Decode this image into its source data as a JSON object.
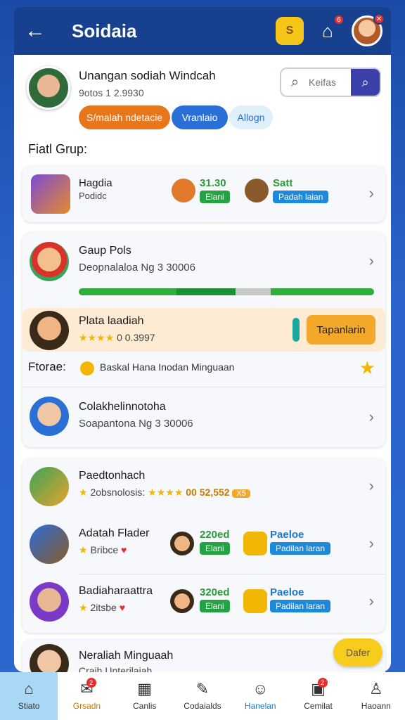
{
  "header": {
    "title": "Soidaia",
    "shield_label": "S",
    "notif_count": "6"
  },
  "profile": {
    "name": "Unangan sodiah Windcah",
    "sub": "9otos 1 2.9930"
  },
  "search": {
    "placeholder": "Keifas"
  },
  "chips": [
    "S/malah ndetacie",
    "Vranlaio",
    "Allogn"
  ],
  "section1": {
    "title": "Fiatl Grup:"
  },
  "card1": {
    "title": "Hagdia",
    "sub": "Podidc",
    "mid_value": "31.30",
    "mid_tag": "Elani",
    "right_title": "Satt",
    "right_tag": "Padah laian"
  },
  "card2": {
    "title": "Gaup Pols",
    "sub": "Deopnalaloa Ng 3 30006",
    "progress": [
      0.33,
      0.2,
      0.12,
      0.35
    ],
    "colors": [
      "#2fae3c",
      "#1f8f37",
      "#c7c7c7",
      "#2fae3c"
    ],
    "highlight_title": "Plata laadiah",
    "highlight_sub": "0 0.3997",
    "highlight_btn": "Tapanlarin",
    "f_label": "Ftorae:",
    "f_text": "Baskal Hana Inodan Minguaan",
    "row3_title": "Colakhelinnotoha",
    "row3_sub": "Soapantona Ng 3 30006"
  },
  "card3": {
    "r1_title": "Paedtonhach",
    "r1_sub": "2obsnolosis:",
    "r1_value": "00 52,552",
    "r1_badge": "X5",
    "r2_title": "Adatah Flader",
    "r2_sub": "Bribce",
    "r2_val": "220ed",
    "r2_tag": "Elani",
    "r2_right": "Paeloe",
    "r2_right_tag": "Padilan laran",
    "r3_title": "Badiaharaattra",
    "r3_sub": "2itsbe",
    "r3_val": "320ed",
    "r3_tag": "Elani",
    "r3_right": "Paeloe",
    "r3_right_tag": "Padilan laran"
  },
  "bottom_row": {
    "title": "Neraliah Minguaah",
    "sub": "Craih Unterilaiah"
  },
  "fab": "Dafer",
  "nav": [
    {
      "label": "Stiato",
      "icon": "⌂",
      "badge": ""
    },
    {
      "label": "Grsadn",
      "icon": "✉",
      "badge": "2"
    },
    {
      "label": "Canlis",
      "icon": "▦",
      "badge": ""
    },
    {
      "label": "Codaialds",
      "icon": "✎",
      "badge": ""
    },
    {
      "label": "Hanelan",
      "icon": "☺",
      "badge": ""
    },
    {
      "label": "Cemilat",
      "icon": "▣",
      "badge": "2"
    },
    {
      "label": "Haoann",
      "icon": "♙",
      "badge": ""
    }
  ],
  "colors": {
    "accent": "#17408f",
    "orange": "#e8761c",
    "blue": "#2a6fd6",
    "green": "#25a244"
  }
}
